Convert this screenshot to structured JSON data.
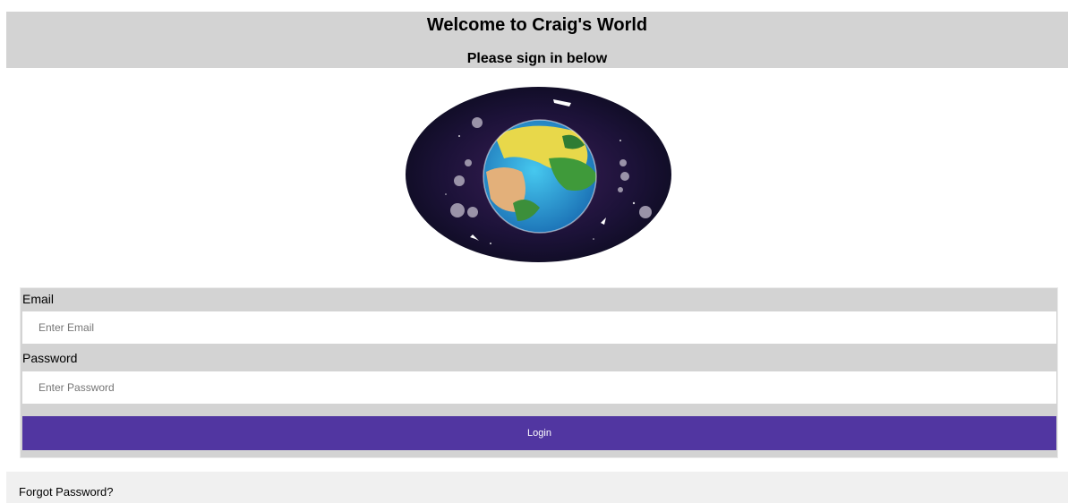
{
  "header": {
    "title": "Welcome to Craig's World",
    "subtitle": "Please sign in below"
  },
  "logo": {
    "icon": "planet-world-icon"
  },
  "form": {
    "email_label": "Email",
    "email_placeholder": "Enter Email",
    "email_value": "",
    "password_label": "Password",
    "password_placeholder": "Enter Password",
    "password_value": "",
    "login_label": "Login"
  },
  "footer": {
    "forgot_label": "Forgot Password?"
  },
  "colors": {
    "header_bg": "#d3d3d3",
    "button_bg": "#5136a1",
    "footer_bg": "#f0f0f0"
  }
}
